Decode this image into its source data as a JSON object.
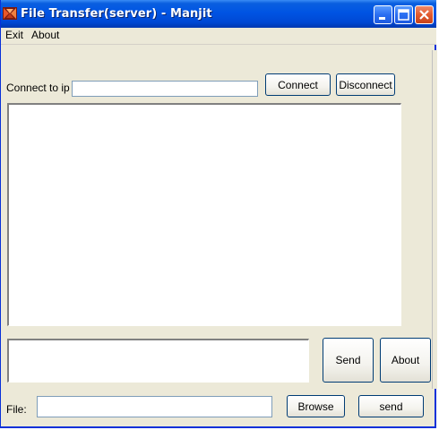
{
  "window": {
    "title": "File Transfer(server) - Manjit",
    "accent": "#0054e3",
    "face": "#ece9d8"
  },
  "titlebar_buttons": {
    "minimize": "minimize-icon",
    "maximize": "maximize-icon",
    "close": "close-icon"
  },
  "menu": {
    "items": [
      "Exit",
      "About"
    ]
  },
  "connect": {
    "label": "Connect to ip :",
    "ip_value": "",
    "connect_button": "Connect",
    "disconnect_button": "Disconnect"
  },
  "chat": {
    "log_text": "",
    "message_text": "",
    "send_button": "Send",
    "about_button": "About"
  },
  "file": {
    "label": "File:",
    "path_value": "",
    "browse_button": "Browse",
    "send_button": "send"
  }
}
